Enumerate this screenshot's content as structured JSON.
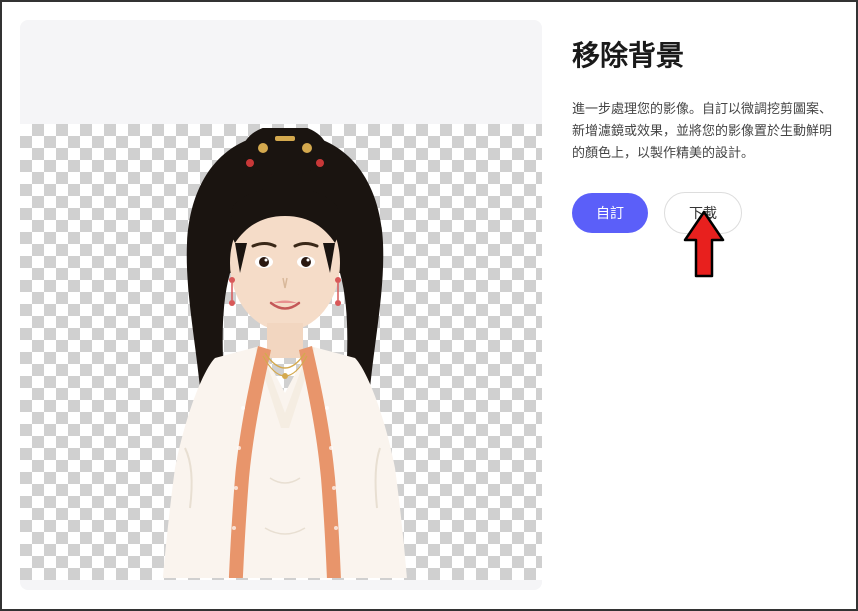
{
  "title": "移除背景",
  "description": "進一步處理您的影像。自訂以微調挖剪圖案、新增濾鏡或效果，並將您的影像置於生動鮮明的顏色上，以製作精美的設計。",
  "buttons": {
    "customize": "自訂",
    "download": "下載"
  },
  "image": {
    "alt": "woman-in-traditional-costume-transparent-background"
  }
}
